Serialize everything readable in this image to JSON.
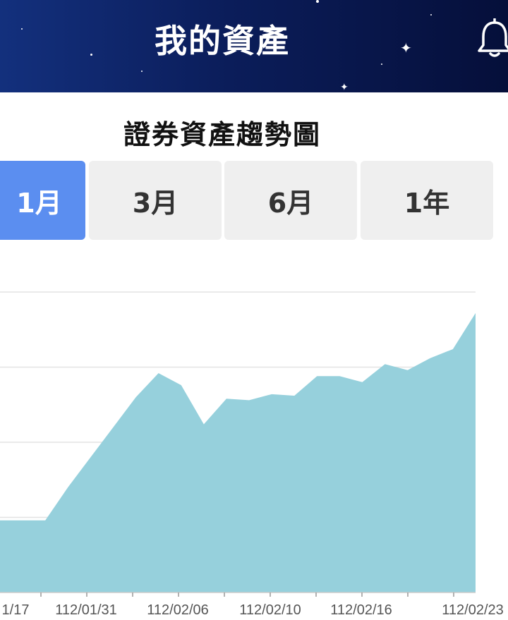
{
  "header": {
    "title": "我的資產"
  },
  "section": {
    "title": "證券資產趨勢圖"
  },
  "tabs": [
    {
      "label": "1月",
      "active": true
    },
    {
      "label": "3月",
      "active": false
    },
    {
      "label": "6月",
      "active": false
    },
    {
      "label": "1年",
      "active": false
    }
  ],
  "colors": {
    "header": "#0b1d5a",
    "active_tab": "#5b8ef0",
    "area_fill": "#96d0dc"
  },
  "chart_data": {
    "type": "area",
    "x_tick_labels": [
      "1/17",
      "112/01/31",
      "112/02/06",
      "112/02/10",
      "112/02/16",
      "112/02/23"
    ],
    "values": [
      0.24,
      0.24,
      0.24,
      0.35,
      0.45,
      0.55,
      0.65,
      0.73,
      0.69,
      0.56,
      0.645,
      0.64,
      0.66,
      0.655,
      0.72,
      0.72,
      0.7,
      0.76,
      0.74,
      0.78,
      0.81,
      0.93
    ],
    "grid": true
  }
}
